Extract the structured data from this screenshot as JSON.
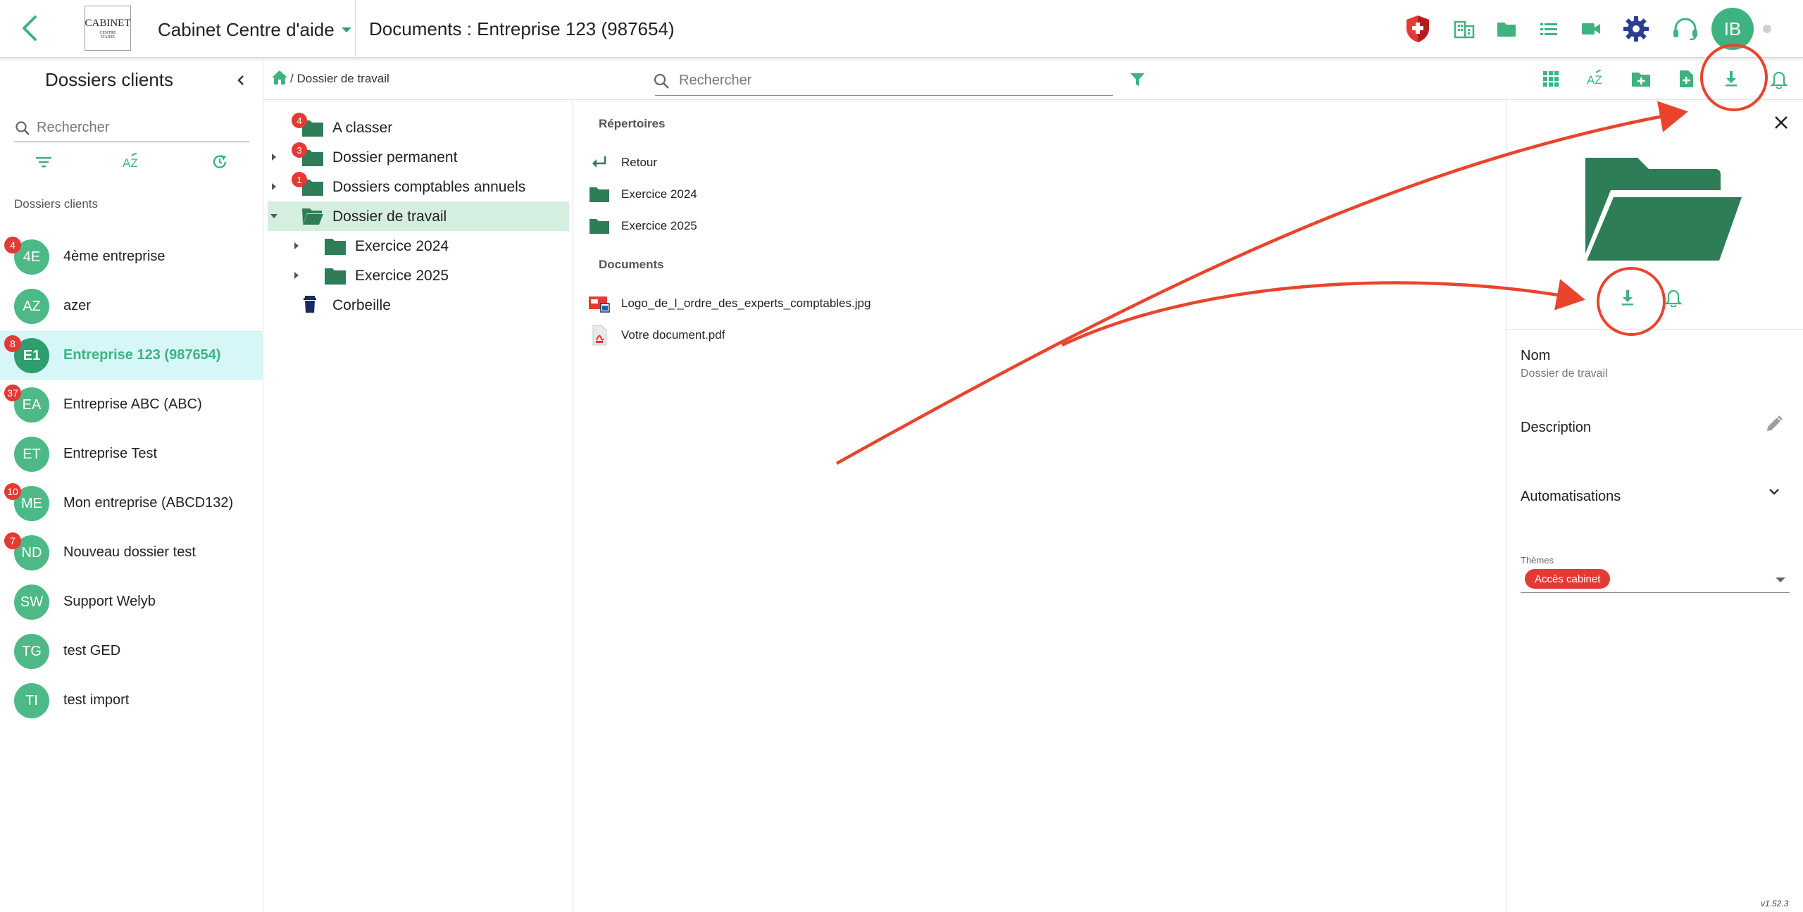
{
  "header": {
    "logo": {
      "line1": "CABINET",
      "line2": "CENTRE",
      "line3": "D'AIDE"
    },
    "cabinet_name": "Cabinet Centre d'aide",
    "page_title": "Documents : Entreprise 123 (987654)",
    "avatar_initials": "IB",
    "icons": [
      "shield-icon",
      "building-icon",
      "folder-icon",
      "list-icon",
      "video-icon",
      "settings-icon",
      "headset-icon"
    ]
  },
  "sidebar": {
    "title": "Dossiers clients",
    "search_placeholder": "Rechercher",
    "section_label": "Dossiers clients",
    "clients": [
      {
        "initials": "4E",
        "name": "4ème entreprise",
        "badge": "4"
      },
      {
        "initials": "AZ",
        "name": "azer",
        "badge": ""
      },
      {
        "initials": "E1",
        "name": "Entreprise 123 (987654)",
        "badge": "8",
        "active": true
      },
      {
        "initials": "EA",
        "name": "Entreprise ABC (ABC)",
        "badge": "37"
      },
      {
        "initials": "ET",
        "name": "Entreprise Test",
        "badge": ""
      },
      {
        "initials": "ME",
        "name": "Mon entreprise (ABCD132)",
        "badge": "10"
      },
      {
        "initials": "ND",
        "name": "Nouveau dossier test",
        "badge": "7"
      },
      {
        "initials": "SW",
        "name": "Support Welyb",
        "badge": ""
      },
      {
        "initials": "TG",
        "name": "test GED",
        "badge": ""
      },
      {
        "initials": "TI",
        "name": "test import",
        "badge": ""
      }
    ]
  },
  "toolbar": {
    "breadcrumb_sep": "/",
    "breadcrumb_current": "Dossier de travail",
    "search_placeholder": "Rechercher"
  },
  "tree": {
    "nodes": [
      {
        "label": "A classer",
        "badge": "4"
      },
      {
        "label": "Dossier permanent",
        "badge": "3"
      },
      {
        "label": "Dossiers comptables annuels",
        "badge": "1"
      },
      {
        "label": "Dossier de travail",
        "badge": ""
      },
      {
        "label": "Exercice 2024",
        "badge": ""
      },
      {
        "label": "Exercice 2025",
        "badge": ""
      },
      {
        "label": "Corbeille",
        "badge": ""
      }
    ]
  },
  "content": {
    "dirs_heading": "Répertoires",
    "back_label": "Retour",
    "directories": [
      "Exercice 2024",
      "Exercice 2025"
    ],
    "docs_heading": "Documents",
    "documents": [
      "Logo_de_l_ordre_des_experts_comptables.jpg",
      "Votre document.pdf"
    ]
  },
  "detail": {
    "name_label": "Nom",
    "name_value": "Dossier de travail",
    "description_label": "Description",
    "automations_label": "Automatisations",
    "themes_label": "Thèmes",
    "theme_chip": "Accès cabinet"
  },
  "version": "v1.52.3",
  "colors": {
    "accent": "#3fb37f",
    "folder": "#2e7d57",
    "badge": "#e53935",
    "active_row": "#d7f6f7",
    "annotation": "#e8452c",
    "settings_icon": "#2c3e8f"
  }
}
